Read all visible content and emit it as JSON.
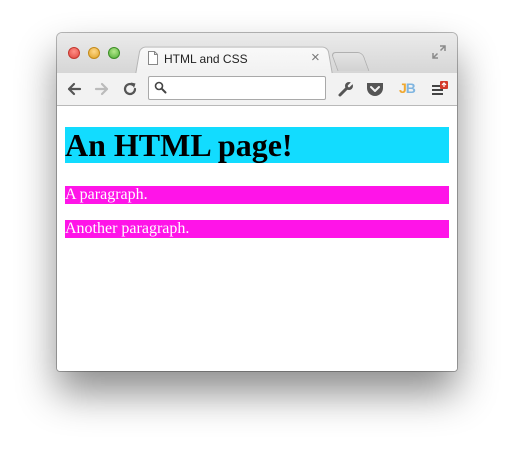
{
  "browser": {
    "tab": {
      "title": "HTML and CSS",
      "close_glyph": "×",
      "icon": "document-icon"
    },
    "toolbar": {
      "icons": [
        "back-arrow-icon",
        "forward-arrow-icon",
        "reload-icon",
        "wrench-icon",
        "pocket-icon",
        "jetbrains-icon",
        "menu-icon"
      ],
      "jb_letters": {
        "j": "J",
        "b": "B"
      }
    },
    "omnibox": {
      "value": "",
      "placeholder": ""
    },
    "colors": {
      "heading_bg": "#12dcff",
      "paragraph_bg": "#ff14e8",
      "paragraph_text": "#ffffff"
    }
  },
  "page": {
    "heading": "An HTML page!",
    "paragraphs": [
      "A paragraph.",
      "Another paragraph."
    ]
  }
}
